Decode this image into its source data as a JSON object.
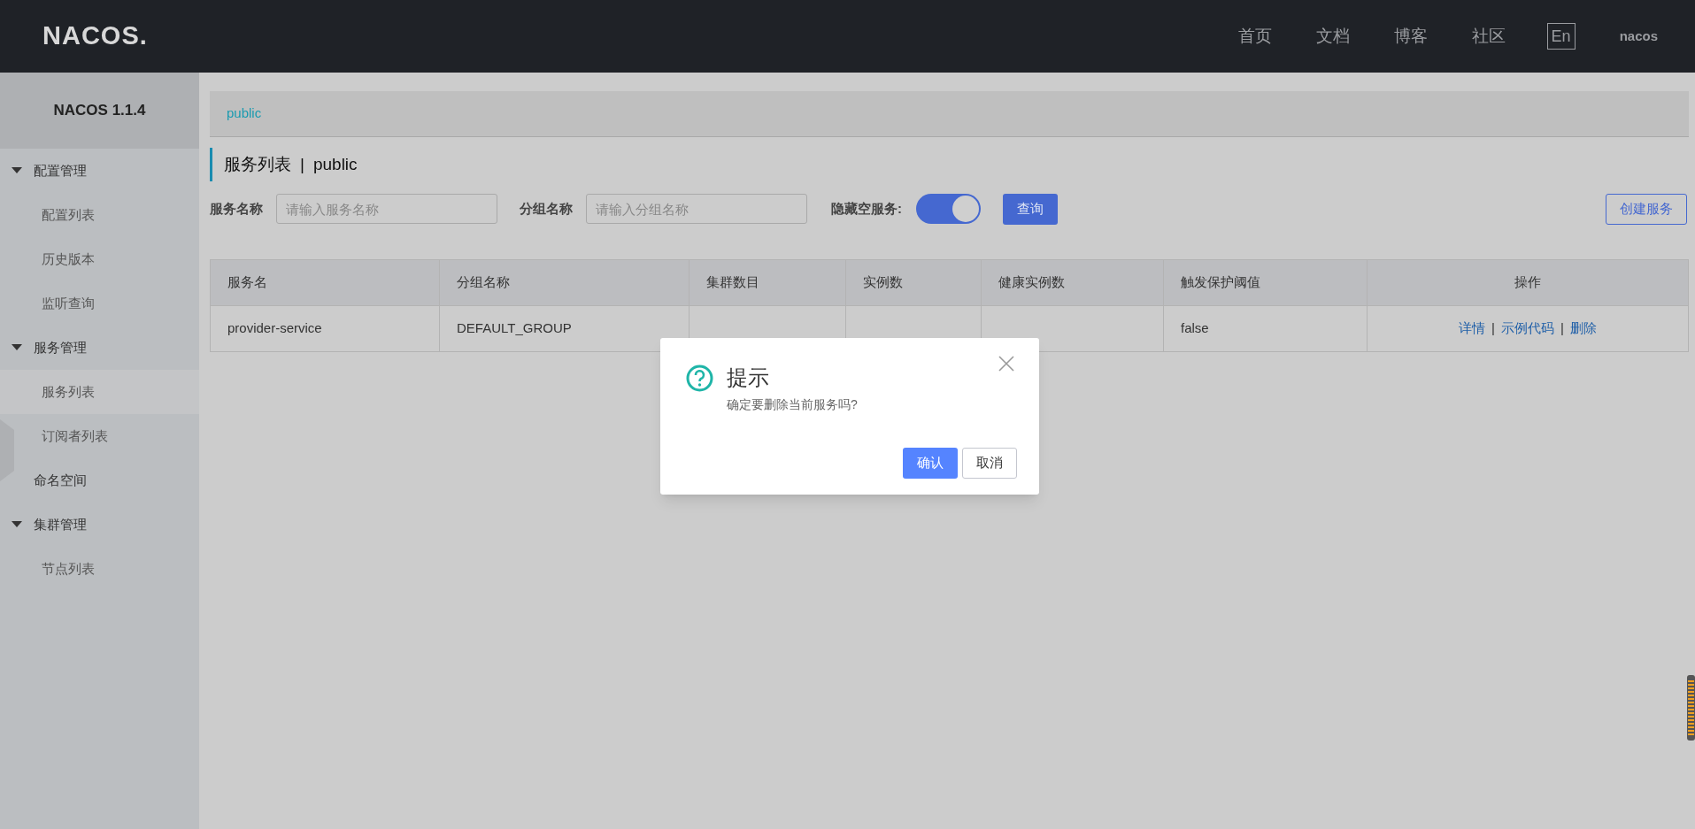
{
  "header": {
    "logo": "NACOS.",
    "nav": [
      "首页",
      "文档",
      "博客",
      "社区"
    ],
    "language": "En",
    "user": "nacos"
  },
  "sidebar": {
    "title": "NACOS 1.1.4",
    "items": [
      {
        "label": "配置管理",
        "expanded": true,
        "children": [
          {
            "label": "配置列表",
            "selected": false
          },
          {
            "label": "历史版本",
            "selected": false
          },
          {
            "label": "监听查询",
            "selected": false
          }
        ]
      },
      {
        "label": "服务管理",
        "expanded": true,
        "children": [
          {
            "label": "服务列表",
            "selected": true
          },
          {
            "label": "订阅者列表",
            "selected": false
          }
        ]
      },
      {
        "label": "命名空间"
      },
      {
        "label": "集群管理",
        "expanded": true,
        "children": [
          {
            "label": "节点列表",
            "selected": false
          }
        ]
      }
    ]
  },
  "breadcrumb": "public",
  "page_title": {
    "title": "服务列表",
    "separator": "|",
    "namespace": "public"
  },
  "filters": [
    {
      "label": "服务名称",
      "placeholder": "请输入服务名称"
    },
    {
      "label": "分组名称",
      "placeholder": "请输入分组名称"
    }
  ],
  "toggle": {
    "label": "隐藏空服务:",
    "on": true
  },
  "query_button": "查询",
  "create_button": "创建服务",
  "table": {
    "columns": [
      "服务名",
      "分组名称",
      "集群数目",
      "实例数",
      "健康实例数",
      "触发保护阈值",
      "操作"
    ],
    "rows": [
      {
        "cells": [
          "provider-service",
          "DEFAULT_GROUP",
          "",
          "",
          "",
          "false"
        ],
        "actions": [
          "详情",
          "示例代码",
          "删除"
        ],
        "action_separators": [
          "|",
          "|"
        ]
      }
    ]
  },
  "dialog": {
    "title": "提示",
    "message": "确定要删除当前服务吗?",
    "buttons": [
      "确认",
      "取消"
    ]
  }
}
